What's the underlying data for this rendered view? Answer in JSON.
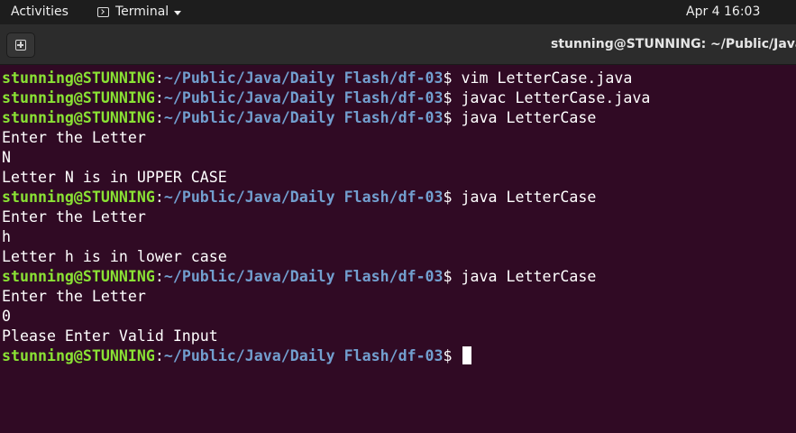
{
  "topbar": {
    "activities_label": "Activities",
    "app_menu_label": "Terminal",
    "clock": "Apr 4  16:03"
  },
  "window": {
    "title": "stunning@STUNNING: ~/Public/Java/Da"
  },
  "prompt": {
    "user_host": "stunning@STUNNING",
    "colon": ":",
    "path": "~/Public/Java/Daily Flash/df-03",
    "dollar": "$ "
  },
  "terminal": {
    "lines": [
      {
        "type": "prompt",
        "command": "vim LetterCase.java"
      },
      {
        "type": "prompt",
        "command": "javac LetterCase.java"
      },
      {
        "type": "prompt",
        "command": "java LetterCase"
      },
      {
        "type": "output",
        "text": "Enter the Letter"
      },
      {
        "type": "output",
        "text": "N"
      },
      {
        "type": "output",
        "text": "Letter N is in UPPER CASE"
      },
      {
        "type": "prompt",
        "command": "java LetterCase"
      },
      {
        "type": "output",
        "text": "Enter the Letter"
      },
      {
        "type": "output",
        "text": "h"
      },
      {
        "type": "output",
        "text": "Letter h is in lower case"
      },
      {
        "type": "prompt",
        "command": "java LetterCase"
      },
      {
        "type": "output",
        "text": "Enter the Letter"
      },
      {
        "type": "output",
        "text": "0"
      },
      {
        "type": "output",
        "text": "Please Enter Valid Input"
      },
      {
        "type": "prompt",
        "command": "",
        "cursor": true
      }
    ]
  },
  "colors": {
    "terminal_background": "#300a24",
    "prompt_user": "#8ae234",
    "prompt_path": "#729fcf",
    "text": "#ffffff"
  }
}
